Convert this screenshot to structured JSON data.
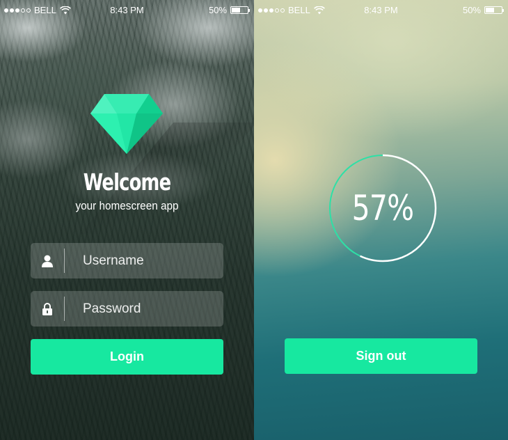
{
  "status_bar": {
    "carrier": "BELL",
    "time": "8:43 PM",
    "battery": "50%",
    "battery_level": 0.5,
    "signal_bars": 3,
    "signal_total": 5,
    "icons": [
      "signal-dots-icon",
      "wifi-icon",
      "battery-icon"
    ]
  },
  "login": {
    "logo_icon": "diamond-icon",
    "title": "Welcome",
    "subtitle": "your homescreen app",
    "username": {
      "icon": "user-icon",
      "placeholder": "Username",
      "value": ""
    },
    "password": {
      "icon": "lock-icon",
      "placeholder": "Password",
      "value": ""
    },
    "login_label": "Login"
  },
  "progress": {
    "percent_label": "57%",
    "percent_value": 0.57,
    "signout_label": "Sign out"
  },
  "colors": {
    "accent": "#17e8a0",
    "gem_light": "#3ff0b4",
    "gem_dark": "#12c98a",
    "ring_green": "#2ee0a6",
    "ring_white": "#ffffff"
  }
}
